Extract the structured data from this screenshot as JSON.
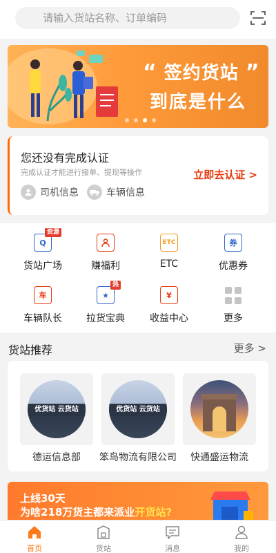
{
  "search": {
    "placeholder": "请输入货站名称、订单编码"
  },
  "banner": {
    "title_line1": "签约货站",
    "title_line2": "到底是什么",
    "pages": 4,
    "active_page": 3
  },
  "auth_card": {
    "title": "您还没有完成认证",
    "subtitle": "完成认证才能进行接单、提现等操作",
    "link": "立即去认证 >",
    "items": [
      {
        "label": "司机信息",
        "icon": "driver-icon"
      },
      {
        "label": "车辆信息",
        "icon": "vehicle-icon"
      }
    ]
  },
  "grid": [
    {
      "label": "货站广场",
      "icon": "plaza-icon",
      "badge": "资源",
      "glyph": "Q"
    },
    {
      "label": "赚福利",
      "icon": "welfare-icon",
      "badge": "",
      "glyph": ""
    },
    {
      "label": "ETC",
      "icon": "etc-icon",
      "badge": "",
      "glyph": "ETC"
    },
    {
      "label": "优惠券",
      "icon": "coupon-icon",
      "badge": "",
      "glyph": "券"
    },
    {
      "label": "车辆队长",
      "icon": "fleet-icon",
      "badge": "",
      "glyph": "车"
    },
    {
      "label": "拉货宝典",
      "icon": "guide-icon",
      "badge": "热",
      "glyph": "★"
    },
    {
      "label": "收益中心",
      "icon": "income-icon",
      "badge": "",
      "glyph": "¥"
    },
    {
      "label": "更多",
      "icon": "more-icon",
      "badge": "",
      "glyph": ""
    }
  ],
  "recommend": {
    "title": "货站推荐",
    "more": "更多 >",
    "stations": [
      {
        "name": "德运信息部",
        "sign": "优货站 云货站"
      },
      {
        "name": "笨鸟物流有限公司",
        "sign": "优货站 云货站"
      },
      {
        "name": "快通盛运物流",
        "sign": ""
      }
    ]
  },
  "promo": {
    "line1": "上线30天",
    "line2_prefix": "为啥218万货主都来派业",
    "line2_highlight": "开货站?"
  },
  "tabs": [
    {
      "label": "首页",
      "icon": "home-icon",
      "active": true
    },
    {
      "label": "货站",
      "icon": "station-icon",
      "active": false
    },
    {
      "label": "消息",
      "icon": "message-icon",
      "active": false
    },
    {
      "label": "我的",
      "icon": "profile-icon",
      "active": false
    }
  ],
  "colors": {
    "accent": "#ff7a1a",
    "link_red": "#e8380d",
    "banner_orange": "#ff9a3a"
  }
}
